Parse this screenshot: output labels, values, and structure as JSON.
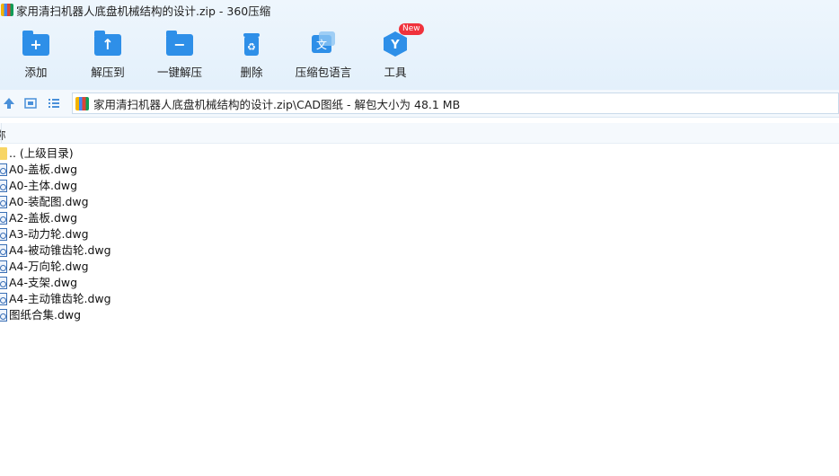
{
  "window": {
    "title": "家用清扫机器人底盘机械结构的设计.zip - 360压缩"
  },
  "toolbar": {
    "items": [
      {
        "label": "添加",
        "icon": "add-folder-icon",
        "glyph": "+"
      },
      {
        "label": "解压到",
        "icon": "extract-to-icon",
        "glyph": "↑"
      },
      {
        "label": "一键解压",
        "icon": "one-click-extract-icon",
        "glyph": "−"
      },
      {
        "label": "删除",
        "icon": "recycle-delete-icon",
        "glyph": "♻"
      },
      {
        "label": "压缩包语言",
        "icon": "archive-language-icon",
        "glyph": "文"
      },
      {
        "label": "工具",
        "icon": "tools-icon",
        "glyph": "Y"
      }
    ],
    "new_badge": "New"
  },
  "address": {
    "path": "家用清扫机器人底盘机械结构的设计.zip\\CAD图纸 - 解包大小为 48.1 MB"
  },
  "list": {
    "header_name": "称",
    "items": [
      {
        "name": ".. (上级目录)",
        "type": "parent"
      },
      {
        "name": "A0-盖板.dwg",
        "type": "file"
      },
      {
        "name": "A0-主体.dwg",
        "type": "file"
      },
      {
        "name": "A0-装配图.dwg",
        "type": "file"
      },
      {
        "name": "A2-盖板.dwg",
        "type": "file"
      },
      {
        "name": "A3-动力轮.dwg",
        "type": "file"
      },
      {
        "name": "A4-被动锥齿轮.dwg",
        "type": "file"
      },
      {
        "name": "A4-万向轮.dwg",
        "type": "file"
      },
      {
        "name": "A4-支架.dwg",
        "type": "file"
      },
      {
        "name": "A4-主动锥齿轮.dwg",
        "type": "file"
      },
      {
        "name": "图纸合集.dwg",
        "type": "file"
      }
    ]
  },
  "colors": {
    "accent": "#2e8fe8",
    "badge": "#f0323c",
    "toolbar_bg": "#e3f0fb"
  }
}
